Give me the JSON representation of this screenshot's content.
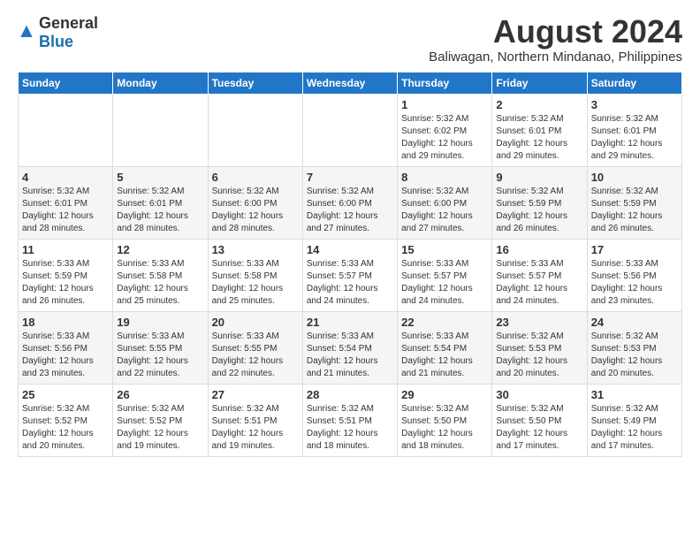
{
  "logo": {
    "general": "General",
    "blue": "Blue"
  },
  "title": {
    "month_year": "August 2024",
    "location": "Baliwagan, Northern Mindanao, Philippines"
  },
  "headers": [
    "Sunday",
    "Monday",
    "Tuesday",
    "Wednesday",
    "Thursday",
    "Friday",
    "Saturday"
  ],
  "weeks": [
    [
      {
        "day": "",
        "info": ""
      },
      {
        "day": "",
        "info": ""
      },
      {
        "day": "",
        "info": ""
      },
      {
        "day": "",
        "info": ""
      },
      {
        "day": "1",
        "info": "Sunrise: 5:32 AM\nSunset: 6:02 PM\nDaylight: 12 hours\nand 29 minutes."
      },
      {
        "day": "2",
        "info": "Sunrise: 5:32 AM\nSunset: 6:01 PM\nDaylight: 12 hours\nand 29 minutes."
      },
      {
        "day": "3",
        "info": "Sunrise: 5:32 AM\nSunset: 6:01 PM\nDaylight: 12 hours\nand 29 minutes."
      }
    ],
    [
      {
        "day": "4",
        "info": "Sunrise: 5:32 AM\nSunset: 6:01 PM\nDaylight: 12 hours\nand 28 minutes."
      },
      {
        "day": "5",
        "info": "Sunrise: 5:32 AM\nSunset: 6:01 PM\nDaylight: 12 hours\nand 28 minutes."
      },
      {
        "day": "6",
        "info": "Sunrise: 5:32 AM\nSunset: 6:00 PM\nDaylight: 12 hours\nand 28 minutes."
      },
      {
        "day": "7",
        "info": "Sunrise: 5:32 AM\nSunset: 6:00 PM\nDaylight: 12 hours\nand 27 minutes."
      },
      {
        "day": "8",
        "info": "Sunrise: 5:32 AM\nSunset: 6:00 PM\nDaylight: 12 hours\nand 27 minutes."
      },
      {
        "day": "9",
        "info": "Sunrise: 5:32 AM\nSunset: 5:59 PM\nDaylight: 12 hours\nand 26 minutes."
      },
      {
        "day": "10",
        "info": "Sunrise: 5:32 AM\nSunset: 5:59 PM\nDaylight: 12 hours\nand 26 minutes."
      }
    ],
    [
      {
        "day": "11",
        "info": "Sunrise: 5:33 AM\nSunset: 5:59 PM\nDaylight: 12 hours\nand 26 minutes."
      },
      {
        "day": "12",
        "info": "Sunrise: 5:33 AM\nSunset: 5:58 PM\nDaylight: 12 hours\nand 25 minutes."
      },
      {
        "day": "13",
        "info": "Sunrise: 5:33 AM\nSunset: 5:58 PM\nDaylight: 12 hours\nand 25 minutes."
      },
      {
        "day": "14",
        "info": "Sunrise: 5:33 AM\nSunset: 5:57 PM\nDaylight: 12 hours\nand 24 minutes."
      },
      {
        "day": "15",
        "info": "Sunrise: 5:33 AM\nSunset: 5:57 PM\nDaylight: 12 hours\nand 24 minutes."
      },
      {
        "day": "16",
        "info": "Sunrise: 5:33 AM\nSunset: 5:57 PM\nDaylight: 12 hours\nand 24 minutes."
      },
      {
        "day": "17",
        "info": "Sunrise: 5:33 AM\nSunset: 5:56 PM\nDaylight: 12 hours\nand 23 minutes."
      }
    ],
    [
      {
        "day": "18",
        "info": "Sunrise: 5:33 AM\nSunset: 5:56 PM\nDaylight: 12 hours\nand 23 minutes."
      },
      {
        "day": "19",
        "info": "Sunrise: 5:33 AM\nSunset: 5:55 PM\nDaylight: 12 hours\nand 22 minutes."
      },
      {
        "day": "20",
        "info": "Sunrise: 5:33 AM\nSunset: 5:55 PM\nDaylight: 12 hours\nand 22 minutes."
      },
      {
        "day": "21",
        "info": "Sunrise: 5:33 AM\nSunset: 5:54 PM\nDaylight: 12 hours\nand 21 minutes."
      },
      {
        "day": "22",
        "info": "Sunrise: 5:33 AM\nSunset: 5:54 PM\nDaylight: 12 hours\nand 21 minutes."
      },
      {
        "day": "23",
        "info": "Sunrise: 5:32 AM\nSunset: 5:53 PM\nDaylight: 12 hours\nand 20 minutes."
      },
      {
        "day": "24",
        "info": "Sunrise: 5:32 AM\nSunset: 5:53 PM\nDaylight: 12 hours\nand 20 minutes."
      }
    ],
    [
      {
        "day": "25",
        "info": "Sunrise: 5:32 AM\nSunset: 5:52 PM\nDaylight: 12 hours\nand 20 minutes."
      },
      {
        "day": "26",
        "info": "Sunrise: 5:32 AM\nSunset: 5:52 PM\nDaylight: 12 hours\nand 19 minutes."
      },
      {
        "day": "27",
        "info": "Sunrise: 5:32 AM\nSunset: 5:51 PM\nDaylight: 12 hours\nand 19 minutes."
      },
      {
        "day": "28",
        "info": "Sunrise: 5:32 AM\nSunset: 5:51 PM\nDaylight: 12 hours\nand 18 minutes."
      },
      {
        "day": "29",
        "info": "Sunrise: 5:32 AM\nSunset: 5:50 PM\nDaylight: 12 hours\nand 18 minutes."
      },
      {
        "day": "30",
        "info": "Sunrise: 5:32 AM\nSunset: 5:50 PM\nDaylight: 12 hours\nand 17 minutes."
      },
      {
        "day": "31",
        "info": "Sunrise: 5:32 AM\nSunset: 5:49 PM\nDaylight: 12 hours\nand 17 minutes."
      }
    ]
  ]
}
